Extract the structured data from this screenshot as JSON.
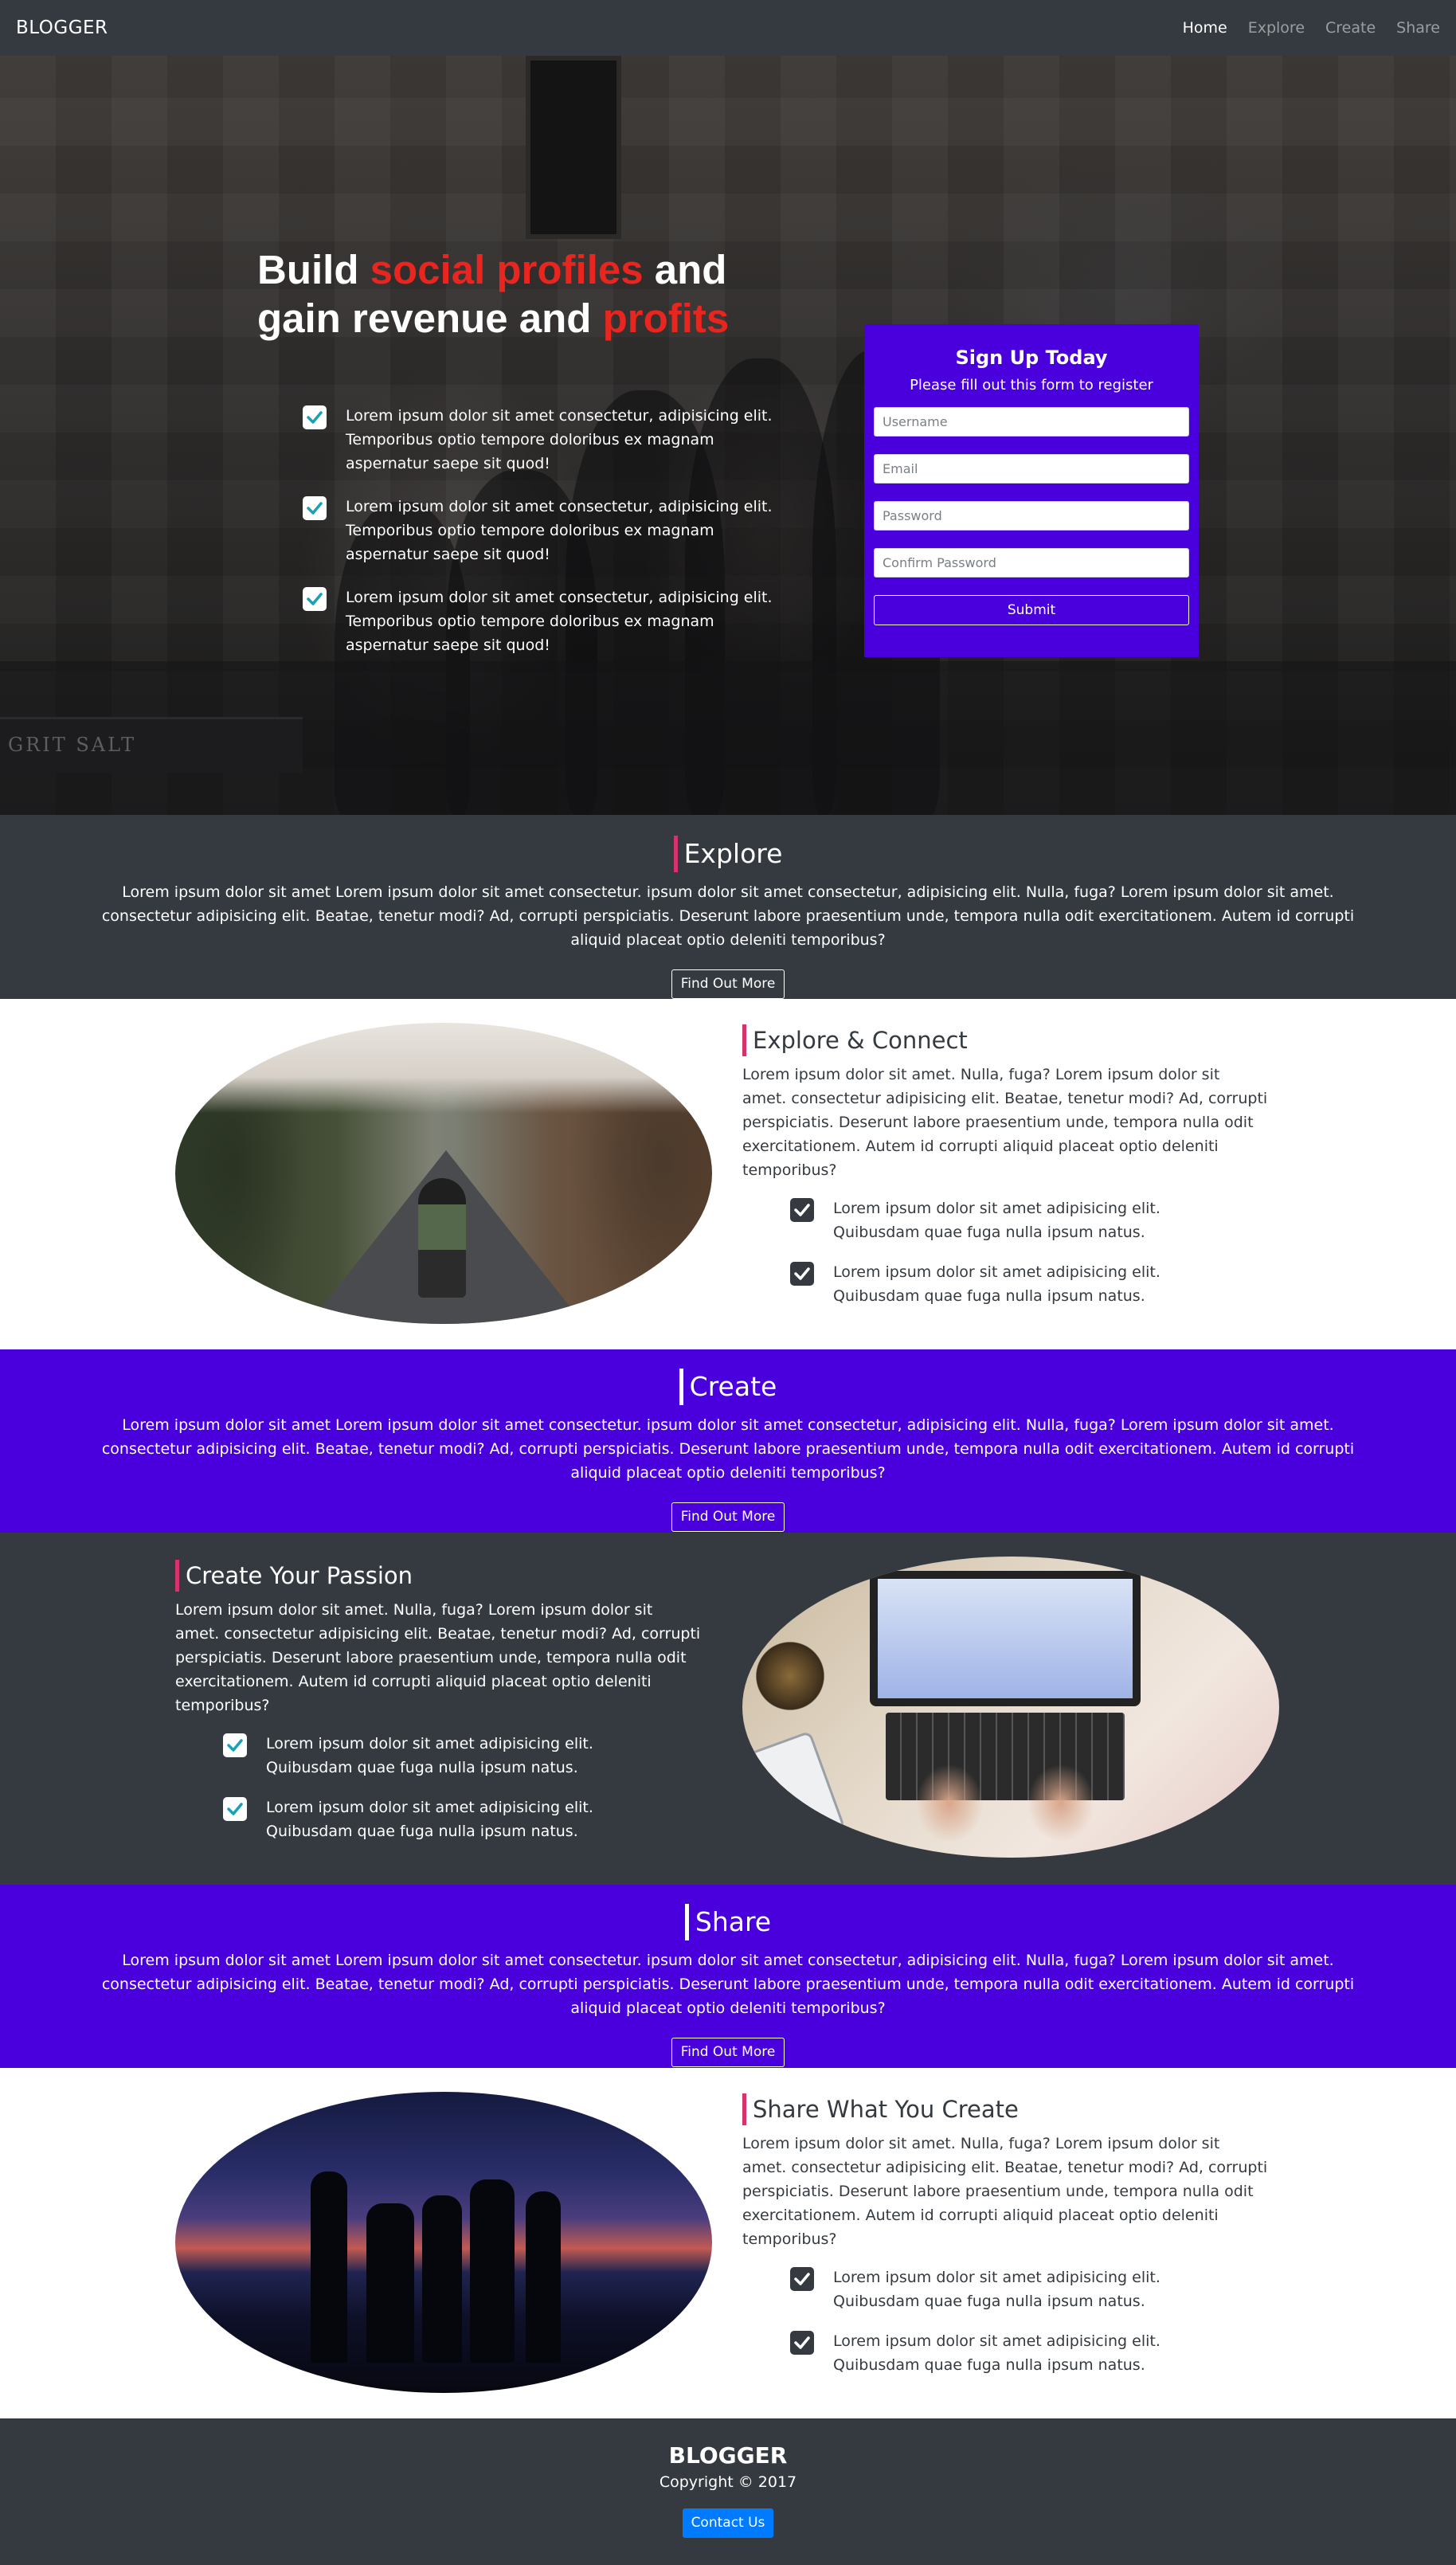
{
  "nav": {
    "brand": "BLOGGER",
    "links": [
      "Home",
      "Explore",
      "Create",
      "Share"
    ]
  },
  "hero": {
    "title_part1": "Build ",
    "title_red1": "social profiles",
    "title_part2": " and gain revenue and ",
    "title_red2": "profits",
    "items": [
      "Lorem ipsum dolor sit amet consectetur, adipisicing elit. Temporibus optio tempore doloribus ex magnam aspernatur saepe sit quod!",
      "Lorem ipsum dolor sit amet consectetur, adipisicing elit. Temporibus optio tempore doloribus ex magnam aspernatur saepe sit quod!",
      "Lorem ipsum dolor sit amet consectetur, adipisicing elit. Temporibus optio tempore doloribus ex magnam aspernatur saepe sit quod!"
    ],
    "sign_text": "GRIT SALT"
  },
  "signup": {
    "title": "Sign Up Today",
    "subtitle": "Please fill out this form to register",
    "username_placeholder": "Username",
    "email_placeholder": "Email",
    "password_placeholder": "Password",
    "confirm_placeholder": "Confirm Password",
    "submit_label": "Submit"
  },
  "band_text": "Lorem ipsum dolor sit amet Lorem ipsum dolor sit amet consectetur. ipsum dolor sit amet consectetur, adipisicing elit. Nulla, fuga? Lorem ipsum dolor sit amet. consectetur adipisicing elit. Beatae, tenetur modi? Ad, corrupti perspiciatis. Deserunt labore praesentium unde, tempora nulla odit exercitationem. Autem id corrupti aliquid placeat optio deleniti temporibus?",
  "find_out_more": "Find Out More",
  "bands": {
    "explore": "Explore",
    "create": "Create",
    "share": "Share"
  },
  "section_desc": "Lorem ipsum dolor sit amet. Nulla, fuga? Lorem ipsum dolor sit amet. consectetur adipisicing elit. Beatae, tenetur modi? Ad, corrupti perspiciatis. Deserunt labore praesentium unde, tempora nulla odit exercitationem. Autem id corrupti aliquid placeat optio deleniti temporibus?",
  "section_item": "Lorem ipsum dolor sit amet adipisicing elit. Quibusdam quae fuga nulla ipsum natus.",
  "sections": {
    "explore_title": "Explore & Connect",
    "create_title": "Create Your Passion",
    "share_title": "Share What You Create"
  },
  "footer": {
    "title": "BLOGGER",
    "copyright": "Copyright © 2017",
    "contact_label": "Contact Us"
  },
  "colors": {
    "dark": "#343a40",
    "purple": "#4a00dc",
    "red_accent": "#e8251f",
    "pink_accent": "#d6336c",
    "primary_button": "#007bff"
  }
}
